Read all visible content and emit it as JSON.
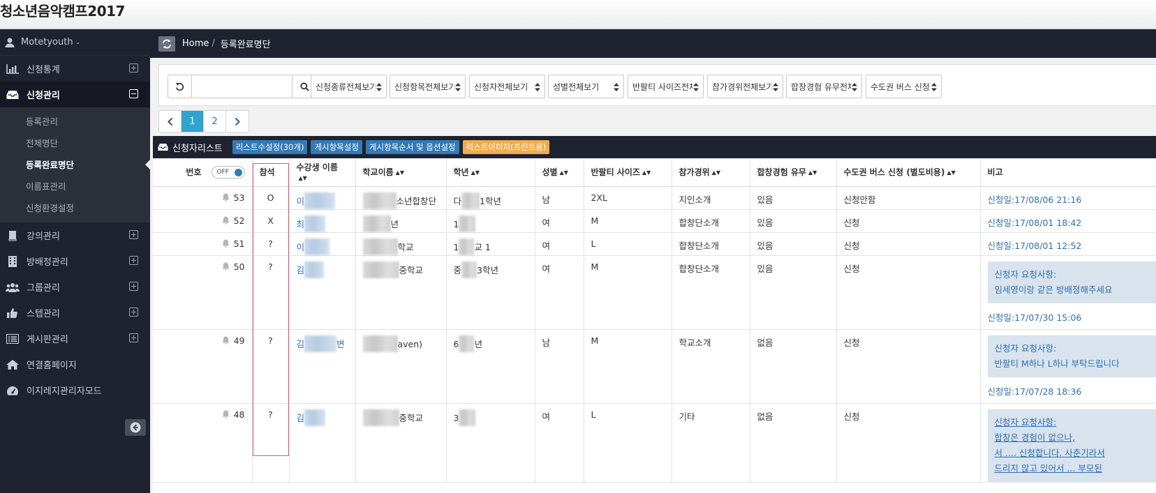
{
  "site": {
    "title": "청소년음악캠프2017"
  },
  "user": {
    "name": "Motetyouth"
  },
  "sidebar": {
    "items": [
      {
        "label": "신청통계",
        "icon": "bar-chart-icon"
      },
      {
        "label": "신청관리",
        "icon": "inbox-icon"
      },
      {
        "label": "강의관리",
        "icon": "book-icon"
      },
      {
        "label": "방배정관리",
        "icon": "building-icon"
      },
      {
        "label": "그룹관리",
        "icon": "users-icon"
      },
      {
        "label": "스텝관리",
        "icon": "thumbs-up-icon"
      },
      {
        "label": "게시판관리",
        "icon": "list-icon"
      },
      {
        "label": "연결홈페이지",
        "icon": "home-icon"
      },
      {
        "label": "이지레지관리자모드",
        "icon": "dashboard-icon"
      }
    ],
    "submenu": [
      "등록관리",
      "전체명단",
      "등록완료명단",
      "이름표관리",
      "신청환경설정"
    ]
  },
  "breadcrumb": {
    "home": "Home",
    "current": "등록완료명단"
  },
  "filters": {
    "search_value": "",
    "selects": [
      "신청종류전체보기",
      "신청항목전체보기",
      "신청자전체보기",
      "성별전체보기",
      "반팔티 사이즈전체",
      "참가경위전체보기",
      "합창경험 유무전체",
      "수도권 버스 신청"
    ]
  },
  "pager": {
    "pages": [
      "1",
      "2"
    ],
    "active": "1"
  },
  "list": {
    "title": "신청자리스트",
    "buttons": [
      "리스트수설정(30개)",
      "게시항목설정",
      "게시항목순서 및 옵션설정"
    ],
    "print_button": "리스트이미지(프린트용)"
  },
  "table": {
    "toggle": "OFF",
    "headers": [
      "번호",
      "참석",
      "수강생 이름",
      "학교이름",
      "학년",
      "성별",
      "반팔티 사이즈",
      "참가경위",
      "합창경험 유무",
      "수도권 버스 신청 (별도비용)",
      "비고"
    ],
    "rows": [
      {
        "no": "53",
        "attend": "O",
        "name": "이",
        "school": "소년합창단",
        "grade_pre": "다",
        "grade": "1학년",
        "gender": "남",
        "size": "2XL",
        "route": "지인소개",
        "exp": "있음",
        "bus": "신청안함",
        "note_label": "",
        "note_text": "",
        "date": "신청일:17/08/06 21:16"
      },
      {
        "no": "52",
        "attend": "X",
        "name": "최",
        "school": "년",
        "grade_pre": "1",
        "grade": "",
        "gender": "여",
        "size": "M",
        "route": "합창단소개",
        "exp": "있음",
        "bus": "신청",
        "note_label": "",
        "note_text": "",
        "date": "신청일:17/08/01 18:42"
      },
      {
        "no": "51",
        "attend": "?",
        "name": "이",
        "school": "학교",
        "grade_pre": "1",
        "grade": "교 1",
        "gender": "여",
        "size": "L",
        "route": "합창단소개",
        "exp": "있음",
        "bus": "신청",
        "note_label": "",
        "note_text": "",
        "date": "신청일:17/08/01 12:52"
      },
      {
        "no": "50",
        "attend": "?",
        "name": "김",
        "school": "중학교",
        "grade_pre": "중",
        "grade": "3학년",
        "gender": "여",
        "size": "M",
        "route": "합창단소개",
        "exp": "있음",
        "bus": "신청",
        "note_label": "신청자 요청사항:",
        "note_text": "임세영이랑 같은 방배정해주세요",
        "date": "신청일:17/07/30 15:06"
      },
      {
        "no": "49",
        "attend": "?",
        "name": "김",
        "school": "aven)",
        "grade_pre": "6",
        "grade": "년",
        "gender": "남",
        "size": "M",
        "route": "학교소개",
        "exp": "없음",
        "bus": "신청",
        "note_label": "신청자 요청사항:",
        "note_text": "반팔티 M하나 L하나 부탁드립니다",
        "date": "신청일:17/07/28 18:36"
      },
      {
        "no": "48",
        "attend": "?",
        "name": "김",
        "school": "중학교",
        "grade_pre": "3",
        "grade": "",
        "gender": "여",
        "size": "L",
        "route": "기타",
        "exp": "없음",
        "bus": "신청",
        "note_label": "신청자 요청사항:",
        "note_lines": [
          "합창은 경험이 없으나,",
          "서 .... 신청합니다. 사춘기라서",
          "드리지 않고 있어서 ... 부모된"
        ],
        "date": ""
      }
    ]
  }
}
